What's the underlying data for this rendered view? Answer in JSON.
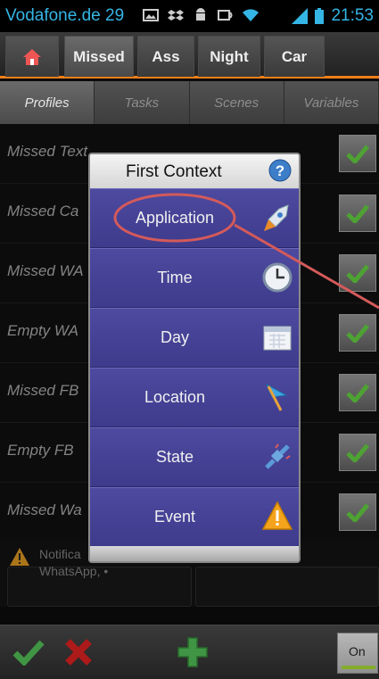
{
  "status_bar": {
    "carrier": "Vodafone.de 29",
    "time": "21:53",
    "icons": [
      "image-icon",
      "dropbox-icon",
      "android-icon",
      "nfc-icon",
      "wifi-icon",
      "signal-icon",
      "battery-icon"
    ]
  },
  "project_tabs": [
    {
      "label": "",
      "icon": "home-icon"
    },
    {
      "label": "Missed"
    },
    {
      "label": "Ass"
    },
    {
      "label": "Night"
    },
    {
      "label": "Car"
    }
  ],
  "section_tabs": [
    "Profiles",
    "Tasks",
    "Scenes",
    "Variables"
  ],
  "profiles": [
    {
      "name": "Missed Text"
    },
    {
      "name": "Missed Ca"
    },
    {
      "name": "Missed WA"
    },
    {
      "name": "Empty WA"
    },
    {
      "name": "Missed FB"
    },
    {
      "name": "Empty FB"
    },
    {
      "name": "Missed Wa"
    }
  ],
  "notification": {
    "line1": "Notifica",
    "line2": "WhatsApp, •"
  },
  "bottom_bar": {
    "toggle_label": "On"
  },
  "dialog": {
    "title": "First Context",
    "items": [
      {
        "label": "Application",
        "icon": "rocket-icon"
      },
      {
        "label": "Time",
        "icon": "clock-icon"
      },
      {
        "label": "Day",
        "icon": "calendar-icon"
      },
      {
        "label": "Location",
        "icon": "flag-icon"
      },
      {
        "label": "State",
        "icon": "plug-icon"
      },
      {
        "label": "Event",
        "icon": "warning-icon"
      }
    ]
  },
  "colors": {
    "accent_blue": "#35b5e5",
    "tab_underline": "#ef7f1a",
    "dialog_item": "#4d4aa0",
    "annotation": "#d45a5a",
    "check_green": "#4caf50",
    "cross_red": "#cc1f1f"
  }
}
